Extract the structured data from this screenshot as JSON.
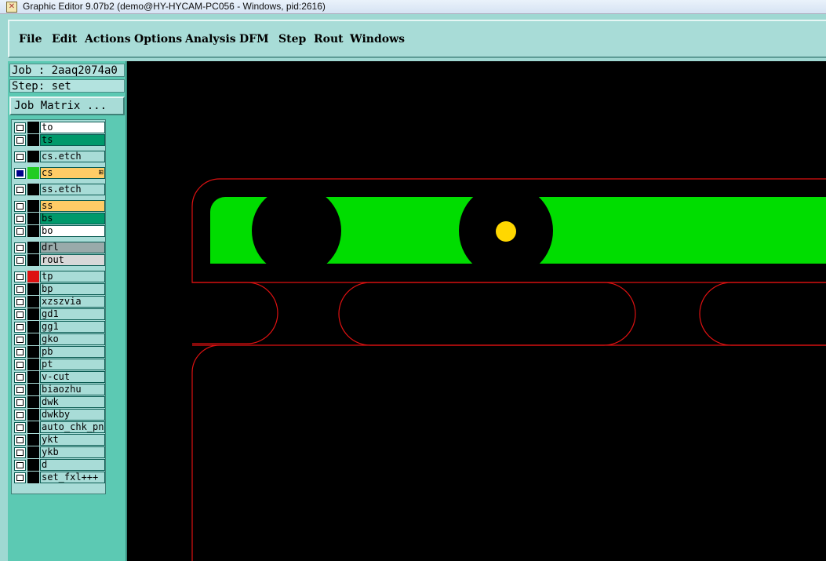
{
  "window": {
    "title": "Graphic Editor 9.07b2 (demo@HY-HYCAM-PC056 - Windows, pid:2616)",
    "icon": "graphic-editor-icon"
  },
  "menu": [
    "File",
    "Edit",
    "Actions",
    "Options",
    "Analysis",
    "DFM",
    "Step",
    "Rout",
    "Windows"
  ],
  "info": {
    "job": "Job : 2aaq2074a0",
    "step": "Step: set",
    "job_matrix": "Job Matrix ..."
  },
  "layers": [
    {
      "name": "to",
      "checked": false,
      "swatch": "#000000",
      "bg": "#ffffff",
      "group": 0
    },
    {
      "name": "ts",
      "checked": false,
      "swatch": "#000000",
      "bg": "#00996b",
      "group": 0
    },
    {
      "name": "cs.etch",
      "checked": false,
      "swatch": "#000000",
      "bg": "#a8dcd7",
      "group": 1
    },
    {
      "name": "cs",
      "checked": true,
      "swatch": "#22cc22",
      "bg": "#ffcc66",
      "group": 2,
      "mark": "⊞"
    },
    {
      "name": "ss.etch",
      "checked": false,
      "swatch": "#000000",
      "bg": "#a8dcd7",
      "group": 3
    },
    {
      "name": "ss",
      "checked": false,
      "swatch": "#000000",
      "bg": "#ffcc66",
      "group": 4
    },
    {
      "name": "bs",
      "checked": false,
      "swatch": "#000000",
      "bg": "#00996b",
      "group": 4
    },
    {
      "name": "bo",
      "checked": false,
      "swatch": "#000000",
      "bg": "#ffffff",
      "group": 4
    },
    {
      "name": "drl",
      "checked": false,
      "swatch": "#000000",
      "bg": "#99aaaa",
      "group": 5
    },
    {
      "name": "rout",
      "checked": false,
      "swatch": "#000000",
      "bg": "#d8d8d8",
      "group": 5
    },
    {
      "name": "tp",
      "checked": false,
      "swatch": "#dd1111",
      "bg": "#a8dcd7",
      "group": 6
    },
    {
      "name": "bp",
      "checked": false,
      "swatch": "#000000",
      "bg": "#a8dcd7",
      "group": 6
    },
    {
      "name": "xzszvia",
      "checked": false,
      "swatch": "#000000",
      "bg": "#a8dcd7",
      "group": 6
    },
    {
      "name": "gd1",
      "checked": false,
      "swatch": "#000000",
      "bg": "#a8dcd7",
      "group": 6
    },
    {
      "name": "gg1",
      "checked": false,
      "swatch": "#000000",
      "bg": "#a8dcd7",
      "group": 6
    },
    {
      "name": "gko",
      "checked": false,
      "swatch": "#000000",
      "bg": "#a8dcd7",
      "group": 6
    },
    {
      "name": "pb",
      "checked": false,
      "swatch": "#000000",
      "bg": "#a8dcd7",
      "group": 6
    },
    {
      "name": "pt",
      "checked": false,
      "swatch": "#000000",
      "bg": "#a8dcd7",
      "group": 6
    },
    {
      "name": "v-cut",
      "checked": false,
      "swatch": "#000000",
      "bg": "#a8dcd7",
      "group": 6
    },
    {
      "name": "biaozhu",
      "checked": false,
      "swatch": "#000000",
      "bg": "#a8dcd7",
      "group": 6
    },
    {
      "name": "dwk",
      "checked": false,
      "swatch": "#000000",
      "bg": "#a8dcd7",
      "group": 6
    },
    {
      "name": "dwkby",
      "checked": false,
      "swatch": "#000000",
      "bg": "#a8dcd7",
      "group": 6
    },
    {
      "name": "auto_chk_pnl",
      "checked": false,
      "swatch": "#000000",
      "bg": "#a8dcd7",
      "group": 6
    },
    {
      "name": "ykt",
      "checked": false,
      "swatch": "#000000",
      "bg": "#a8dcd7",
      "group": 6
    },
    {
      "name": "ykb",
      "checked": false,
      "swatch": "#000000",
      "bg": "#a8dcd7",
      "group": 6
    },
    {
      "name": "d",
      "checked": false,
      "swatch": "#000000",
      "bg": "#a8dcd7",
      "group": 6
    },
    {
      "name": "set_fxl+++",
      "checked": false,
      "swatch": "#000000",
      "bg": "#a8dcd7",
      "group": 6
    }
  ],
  "colors": {
    "copper": "#00dd00",
    "pad": "#ffd700",
    "outline": "#dd1111",
    "canvas": "#000000"
  }
}
